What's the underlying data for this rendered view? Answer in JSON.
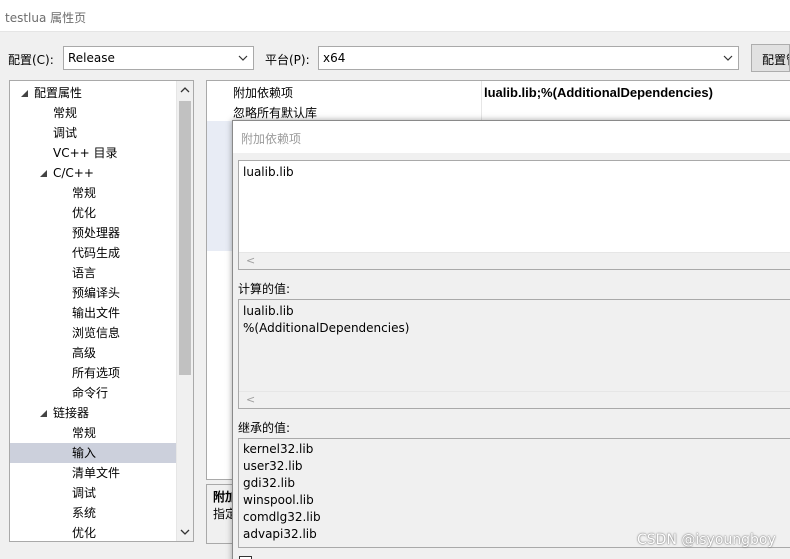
{
  "window": {
    "title": "testlua 属性页"
  },
  "toolbar": {
    "config_label": "配置(C):",
    "config_value": "Release",
    "platform_label": "平台(P):",
    "platform_value": "x64",
    "config_manager_label": "配置管理器"
  },
  "tree": {
    "items": [
      {
        "label": "配置属性",
        "level": 0,
        "expander": "collapse"
      },
      {
        "label": "常规",
        "level": 1
      },
      {
        "label": "调试",
        "level": 1
      },
      {
        "label": "VC++ 目录",
        "level": 1
      },
      {
        "label": "C/C++",
        "level": 1,
        "expander": "collapse"
      },
      {
        "label": "常规",
        "level": 2
      },
      {
        "label": "优化",
        "level": 2
      },
      {
        "label": "预处理器",
        "level": 2
      },
      {
        "label": "代码生成",
        "level": 2
      },
      {
        "label": "语言",
        "level": 2
      },
      {
        "label": "预编译头",
        "level": 2
      },
      {
        "label": "输出文件",
        "level": 2
      },
      {
        "label": "浏览信息",
        "level": 2
      },
      {
        "label": "高级",
        "level": 2
      },
      {
        "label": "所有选项",
        "level": 2
      },
      {
        "label": "命令行",
        "level": 2
      },
      {
        "label": "链接器",
        "level": 1,
        "expander": "collapse"
      },
      {
        "label": "常规",
        "level": 2
      },
      {
        "label": "输入",
        "level": 2,
        "selected": true
      },
      {
        "label": "清单文件",
        "level": 2
      },
      {
        "label": "调试",
        "level": 2
      },
      {
        "label": "系统",
        "level": 2
      },
      {
        "label": "优化",
        "level": 2
      }
    ]
  },
  "grid": {
    "rows": [
      {
        "key": "附加依赖项",
        "value": "lualib.lib;%(AdditionalDependencies)"
      },
      {
        "key": "忽略所有默认库",
        "value": ""
      }
    ]
  },
  "description": {
    "title": "附加",
    "text": "指定"
  },
  "dialog": {
    "title": "附加依赖项",
    "edit_text": "lualib.lib",
    "computed_label": "计算的值:",
    "computed_lines": [
      "lualib.lib",
      "%(AdditionalDependencies)"
    ],
    "inherited_label": "继承的值:",
    "inherited_lines": [
      "kernel32.lib",
      "user32.lib",
      "gdi32.lib",
      "winspool.lib",
      "comdlg32.lib",
      "advapi32.lib"
    ],
    "scroll_left": "<"
  },
  "watermark": "CSDN @isyoungboy",
  "icons": [
    "chevron-down-icon",
    "tree-collapse-icon",
    "scroll-up-icon",
    "scroll-down-icon",
    "scroll-left-icon"
  ],
  "colors": {
    "selection": "#ccd0dc",
    "border": "#a9a9a9",
    "background": "#f0f0f0"
  }
}
